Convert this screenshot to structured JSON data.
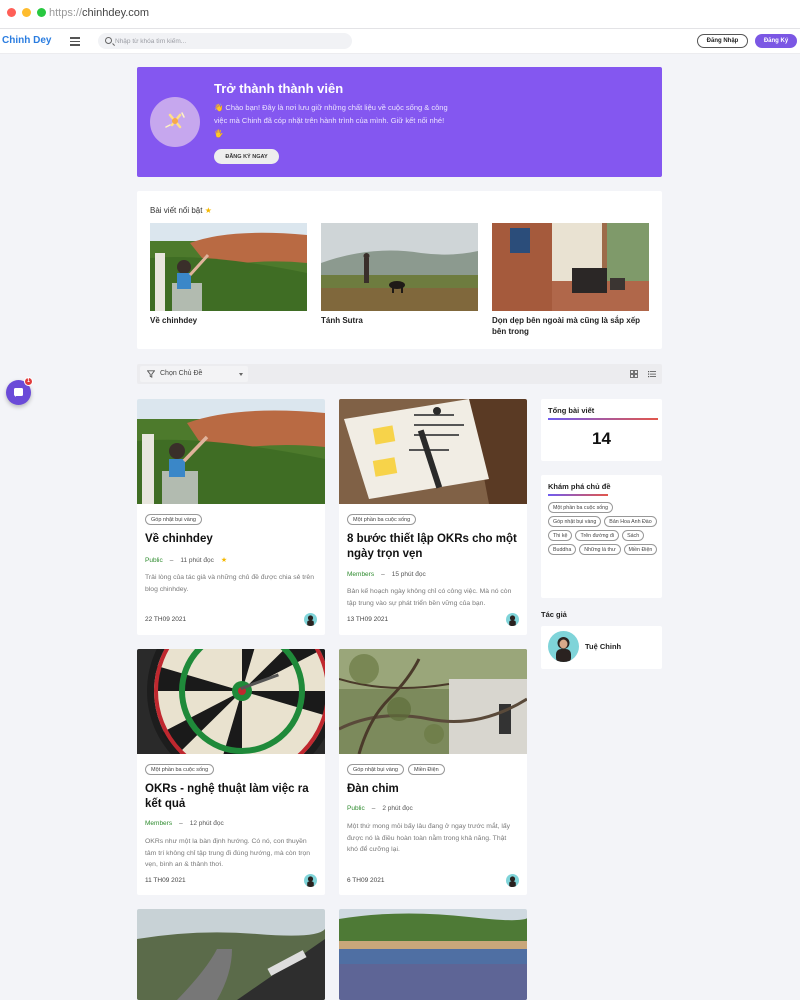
{
  "browser": {
    "url_scheme": "https://",
    "url_host": "chinhdey.com"
  },
  "header": {
    "logo": "Chinh Dey",
    "search_placeholder": "Nhập từ khóa tìm kiếm...",
    "login_label": "Đăng Nhập",
    "signup_label": "Đăng Ký"
  },
  "banner": {
    "title": "Trở thành thành viên",
    "text": "👋 Chào bạn! Đây là nơi lưu giữ những chất liệu về cuộc sống & công việc mà Chinh đã cóp nhặt trên hành trình của mình. Giữ kết nối nhé! 🖐",
    "cta": "ĐĂNG KÝ NGAY",
    "background_color": "#8457f0"
  },
  "featured": {
    "heading": "Bài viết nổi bật",
    "items": [
      {
        "title": "Về chinhdey"
      },
      {
        "title": "Tánh Sutra"
      },
      {
        "title": "Dọn dẹp bên ngoài mà cũng là sắp xếp bên trong"
      }
    ]
  },
  "filter": {
    "topic_label": "Chọn Chủ Đề"
  },
  "posts": [
    {
      "tags": [
        "Góp nhặt bụi vàng"
      ],
      "title": "Về chinhdey",
      "visibility": "Public",
      "read_time": "11 phút đọc",
      "separator": "–",
      "excerpt": "Trải lòng của tác giả và những chủ đề được chia sẻ trên blog chinhdey.",
      "date": "22 TH09 2021"
    },
    {
      "tags": [
        "Một phần ba cuộc sống"
      ],
      "title": "8 bước thiết lập OKRs cho một ngày trọn vẹn",
      "visibility": "Members",
      "read_time": "15 phút đọc",
      "separator": "–",
      "excerpt": "Bản kế hoạch ngày không chỉ có công việc. Mà nó còn tập trung vào sự phát triển bền vững của bạn.",
      "date": "13 TH09 2021"
    },
    {
      "tags": [
        "Một phần ba cuộc sống"
      ],
      "title": "OKRs - nghệ thuật làm việc ra kết quả",
      "visibility": "Members",
      "read_time": "12 phút đọc",
      "separator": "–",
      "excerpt": "OKRs như một la bàn định hướng. Có nó, con thuyền tâm trí không chỉ tập trung đi đúng hướng, mà còn trọn vẹn, bình an & thảnh thơi.",
      "date": "11 TH09 2021"
    },
    {
      "tags": [
        "Góp nhặt bụi vàng",
        "Miền Điện"
      ],
      "title": "Đàn chim",
      "visibility": "Public",
      "read_time": "2 phút đọc",
      "separator": "–",
      "excerpt": "Một thứ mong mỏi bấy lâu đang ở ngay trước mắt, lấy được nó là điều hoàn toàn nằm trong khả năng. Thật khó để cưỡng lại.",
      "date": "6 TH09 2021"
    }
  ],
  "sidebar": {
    "total_title": "Tổng bài viết",
    "total_count": "14",
    "topics_title": "Khám phá chủ đề",
    "topics": [
      "Một phần ba cuộc sống",
      "Góp nhặt bụi vàng",
      "Bản Hoa Anh Đào",
      "Thi kệ",
      "Trên đường đi",
      "Sách",
      "Buddha",
      "Những lá thư",
      "Miền Điện"
    ],
    "author_heading": "Tác giả",
    "author_name": "Tuệ Chinh"
  },
  "chat": {
    "badge_count": "1"
  },
  "colors": {
    "accent": "#7b57e4",
    "public": "#2e8b2e",
    "members": "#2e8b2e",
    "star": "#f5b800"
  },
  "icons": [
    "search-icon",
    "menu-icon",
    "star-icon",
    "funnel-icon",
    "chevron-down-icon",
    "grid-view-icon",
    "list-view-icon",
    "chat-icon"
  ]
}
